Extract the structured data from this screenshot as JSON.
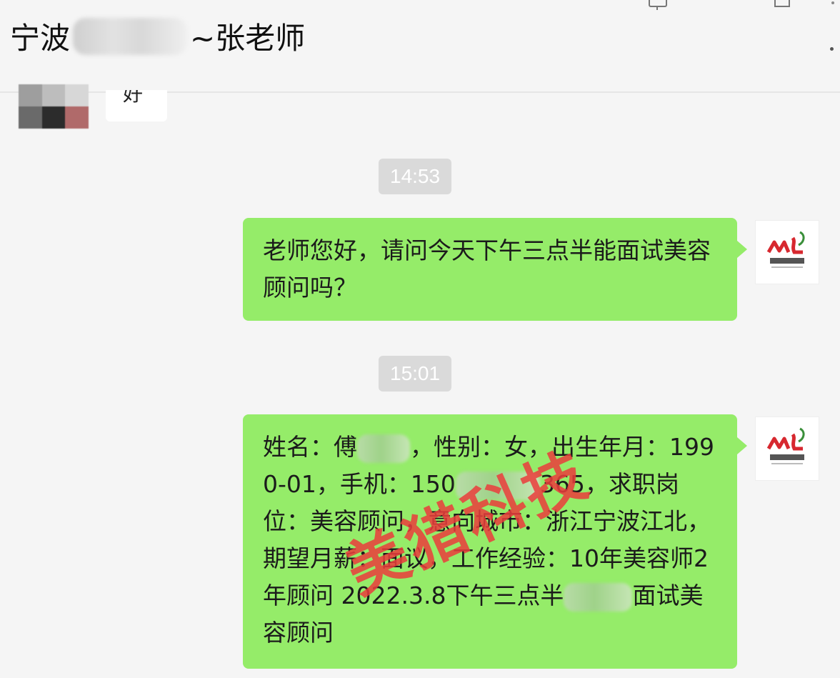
{
  "chat": {
    "title_prefix": "宁波",
    "title_suffix": "~张老师"
  },
  "previous_message": {
    "text": "好"
  },
  "messages": [
    {
      "timestamp": "14:53",
      "text": "老师您好，请问今天下午三点半能面试美容顾问吗？"
    },
    {
      "timestamp": "15:01",
      "parts": [
        "姓名：傅",
        "，性别：女，出生年月：1990-01，手机：150",
        "365，求职岗位：美容顾问，意向城市：浙江宁波江北，期望月薪：面议，工作经验：10年美容师2年顾问 2022.3.8下午三点半",
        "面试美容顾问"
      ]
    }
  ],
  "avatar": {
    "logo_text": "ML",
    "caption": "美猎科技",
    "brand_color": "#d7282f"
  },
  "watermark": {
    "text": "美猎科技",
    "color": "#eb3c3c"
  },
  "colors": {
    "bubble": "#95ec69",
    "background": "#f5f5f5",
    "timestamp_bg": "#dadada"
  }
}
